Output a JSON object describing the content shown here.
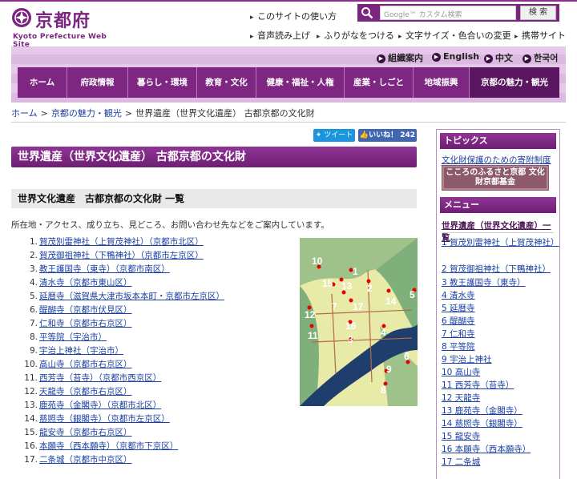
{
  "header": {
    "logo_ja": "京都府",
    "logo_en": "Kyoto Prefecture Web Site",
    "util_links": [
      "このサイトの使い方",
      "音声読み上げ",
      "ふりがなをつける",
      "文字サイズ・色合いの変更",
      "携帯サイト"
    ],
    "search": {
      "placeholder": "Google™ カスタム検索",
      "button": "検 索"
    },
    "languages": [
      "組織案内",
      "English",
      "中文",
      "한국어"
    ],
    "nav": [
      "ホーム",
      "府政情報",
      "暮らし・環境",
      "教育・文化",
      "健康・福祉・人権",
      "産業・しごと",
      "地域振興",
      "京都の魅力・観光"
    ]
  },
  "breadcrumb": [
    "ホーム",
    "京都の魅力・観光",
    "世界遺産（世界文化遺産） 古都京都の文化財"
  ],
  "social": {
    "tweet": "ツイート",
    "like": "いいね！ 242"
  },
  "main": {
    "title": "世界遺産（世界文化遺産） 古都京都の文化財",
    "subtitle": "世界文化遺産　古都京都の文化財 一覧",
    "intro": "所在地・アクセス、成り立ち、見どころ、お問い合わせ先などをご案内しています。",
    "sites": [
      "賀茂別雷神社（上賀茂神社）（京都市北区）",
      "賀茂御祖神社（下鴨神社）（京都市左京区）",
      "教王護国寺（東寺）（京都市南区）",
      "清水寺（京都市東山区）",
      "延暦寺（滋賀県大津市坂本本町・京都市左京区）",
      "醍醐寺（京都市伏見区）",
      "仁和寺（京都市右京区）",
      "平等院（宇治市）",
      "宇治上神社（宇治市）",
      "高山寺（京都市右京区）",
      "西芳寺（苔寺）（京都市西京区）",
      "天龍寺（京都市右京区）",
      "鹿苑寺（金閣寺）（京都市北区）",
      "慈照寺（銀閣寺）（京都市左京区）",
      "龍安寺（京都市右京区）",
      "本願寺（西本願寺）（京都市下京区）",
      "二条城（京都市中京区）"
    ],
    "map_numbers": [
      "1",
      "2",
      "3",
      "4",
      "5",
      "6",
      "7",
      "8",
      "9",
      "10",
      "11",
      "12",
      "13",
      "14",
      "15",
      "16",
      "17"
    ]
  },
  "sidebar": {
    "topics_title": "トピックス",
    "topics_link": "文化財保護のための寄附制度",
    "banner_text": "こころのふるさと京都 文化財京都基金",
    "menu_title": "メニュー",
    "menu_head": "世界遺産（世界文化遺産）一覧",
    "menu": [
      "1 賀茂別雷神社（上賀茂神社）",
      "2 賀茂御祖神社（下鴨神社）",
      "3 教王護国寺（東寺）",
      "4 清水寺",
      "5 延暦寺",
      "6 醍醐寺",
      "7 仁和寺",
      "8 平等院",
      "9 宇治上神社",
      "10 高山寺",
      "11 西芳寺（苔寺）",
      "12 天龍寺",
      "13 鹿苑寺（金閣寺）",
      "14 慈照寺（銀閣寺）",
      "15 龍安寺",
      "16 本願寺（西本願寺）",
      "17 二条城"
    ]
  },
  "colors": {
    "brand_purple": "#7d2783",
    "link": "#1a3fa0"
  }
}
